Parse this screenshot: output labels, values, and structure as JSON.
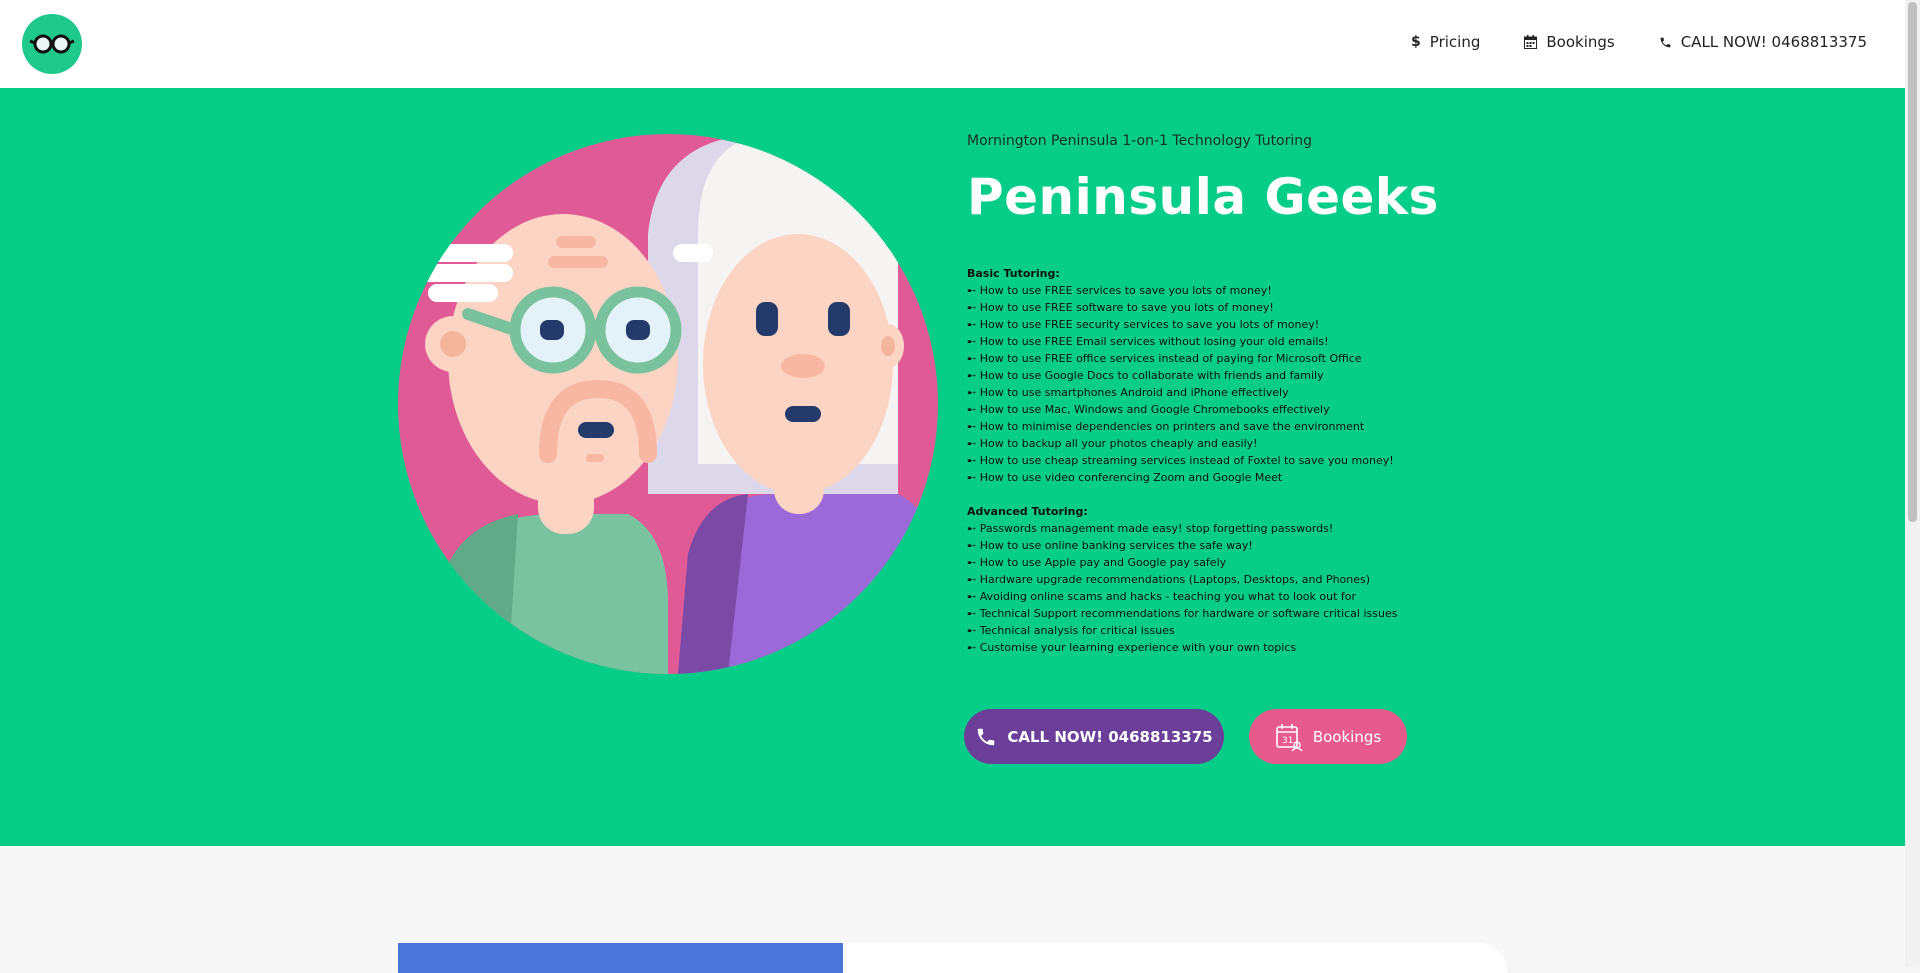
{
  "header": {
    "logo_icon": "glasses-icon",
    "nav": [
      {
        "icon": "dollar-icon",
        "label": "Pricing"
      },
      {
        "icon": "calendar-icon",
        "label": "Bookings"
      },
      {
        "icon": "phone-icon",
        "label": "CALL NOW! 0468813375"
      }
    ]
  },
  "hero": {
    "eyebrow": "Mornington Peninsula 1-on-1 Technology Tutoring",
    "title": "Peninsula Geeks",
    "basic_heading": "Basic Tutoring:",
    "basic_items": [
      "➸ How to use FREE services to save you lots of money!",
      "➸ How to use FREE software to save you lots of money!",
      "➸ How to use FREE security services to save you lots of money!",
      "➸ How to use FREE Email services without losing your old emails!",
      "➸ How to use FREE office services instead of paying for Microsoft Office",
      "➸ How to use Google Docs to collaborate with friends and family",
      "➸ How to use smartphones Android and iPhone effectively",
      "➸ How to use Mac, Windows and Google Chromebooks effectively",
      "➸ How to minimise dependencies on printers and save the environment",
      "➸ How to backup all your photos cheaply and easily!",
      "➸ How to use cheap streaming services instead of Foxtel to save you money!",
      "➸ How to use video conferencing Zoom and Google Meet"
    ],
    "advanced_heading": "Advanced Tutoring:",
    "advanced_items": [
      "➸ Passwords management made easy! stop forgetting passwords!",
      "➸ How to use online banking services the safe way!",
      "➸ How to use Apple pay and Google pay safely",
      "➸ Hardware upgrade recommendations (Laptops, Desktops, and Phones)",
      "➸ Avoiding online scams and hacks - teaching you what to look out for",
      "➸ Technical Support recommendations for hardware or software critical issues",
      "➸ Technical analysis for critical issues",
      "➸ Customise your learning experience with your own topics"
    ],
    "call_button": "CALL NOW! 0468813375",
    "bookings_button": "Bookings",
    "calendar_badge": "31"
  },
  "colors": {
    "hero_bg": "#06ce88",
    "call_button": "#6b3f99",
    "bookings_button": "#e65a8c",
    "logo_bg": "#1ec98b"
  }
}
